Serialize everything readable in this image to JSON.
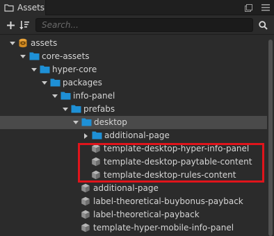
{
  "panel": {
    "title": "Assets"
  },
  "toolbar": {
    "search_placeholder": "Search..."
  },
  "colors": {
    "folder": "#1e90d6",
    "db_root": "#e8a23a",
    "prefab": "#9a9a9a",
    "highlight": "#e0141b",
    "selected_row": "#4a4a4a"
  },
  "tree": {
    "items": [
      {
        "label": "assets",
        "icon": "database-icon",
        "expanded": true
      },
      {
        "label": "core-assets",
        "icon": "folder-icon",
        "expanded": true
      },
      {
        "label": "hyper-core",
        "icon": "folder-icon",
        "expanded": true
      },
      {
        "label": "packages",
        "icon": "folder-icon",
        "expanded": true
      },
      {
        "label": "info-panel",
        "icon": "folder-icon",
        "expanded": true
      },
      {
        "label": "prefabs",
        "icon": "folder-icon",
        "expanded": true
      },
      {
        "label": "desktop",
        "icon": "folder-icon",
        "expanded": true,
        "selected": true
      },
      {
        "label": "additional-page",
        "icon": "folder-icon",
        "expanded": false
      },
      {
        "label": "template-desktop-hyper-info-panel",
        "icon": "prefab-icon"
      },
      {
        "label": "template-desktop-paytable-content",
        "icon": "prefab-icon"
      },
      {
        "label": "template-desktop-rules-content",
        "icon": "prefab-icon"
      },
      {
        "label": "additional-page",
        "icon": "prefab-icon"
      },
      {
        "label": "label-theoretical-buybonus-payback",
        "icon": "prefab-icon"
      },
      {
        "label": "label-theoretical-payback",
        "icon": "prefab-icon"
      },
      {
        "label": "template-hyper-mobile-info-panel",
        "icon": "prefab-icon"
      }
    ]
  }
}
